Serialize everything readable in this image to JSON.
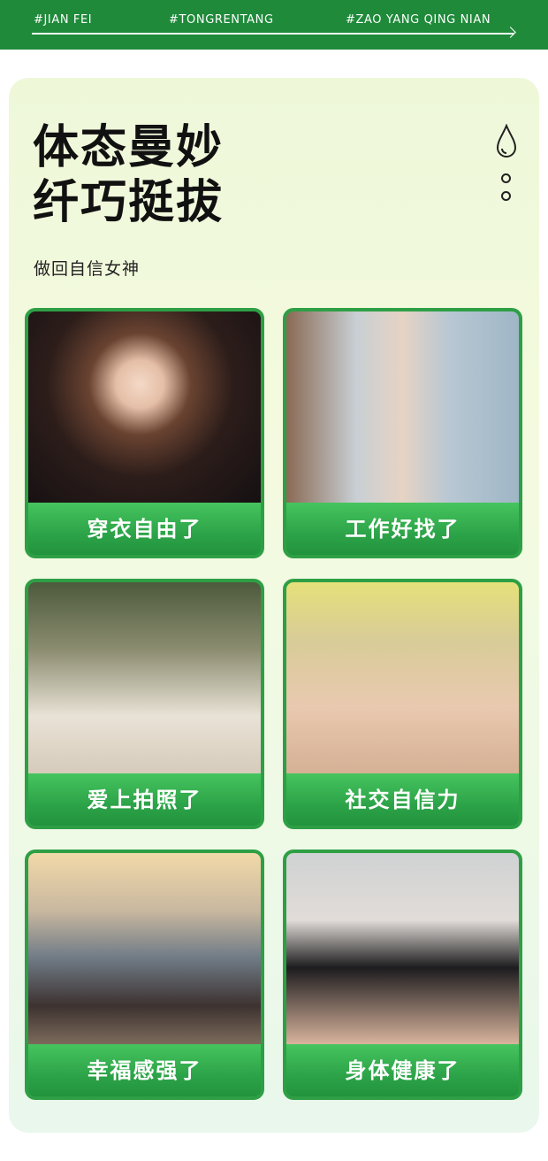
{
  "header": {
    "tags": [
      "#JIAN FEI",
      "#TONGRENTANG",
      "#ZAO YANG QING NIAN"
    ]
  },
  "hero": {
    "title_line1": "体态曼妙",
    "title_line2": "纤巧挺拔",
    "subtitle": "做回自信女神"
  },
  "cards": [
    {
      "caption": "穿衣自由了",
      "photo": "woman-white-top-photo"
    },
    {
      "caption": "工作好找了",
      "photo": "woman-business-suit-photo"
    },
    {
      "caption": "爱上拍照了",
      "photo": "group-selfie-photo"
    },
    {
      "caption": "社交自信力",
      "photo": "friends-robes-photo"
    },
    {
      "caption": "幸福感强了",
      "photo": "couple-seaside-photo"
    },
    {
      "caption": "身体健康了",
      "photo": "woman-gym-photo"
    }
  ],
  "colors": {
    "brand_green": "#1f8a3a",
    "card_green": "#2e9f45",
    "panel_bg": "#f1f9e0"
  }
}
